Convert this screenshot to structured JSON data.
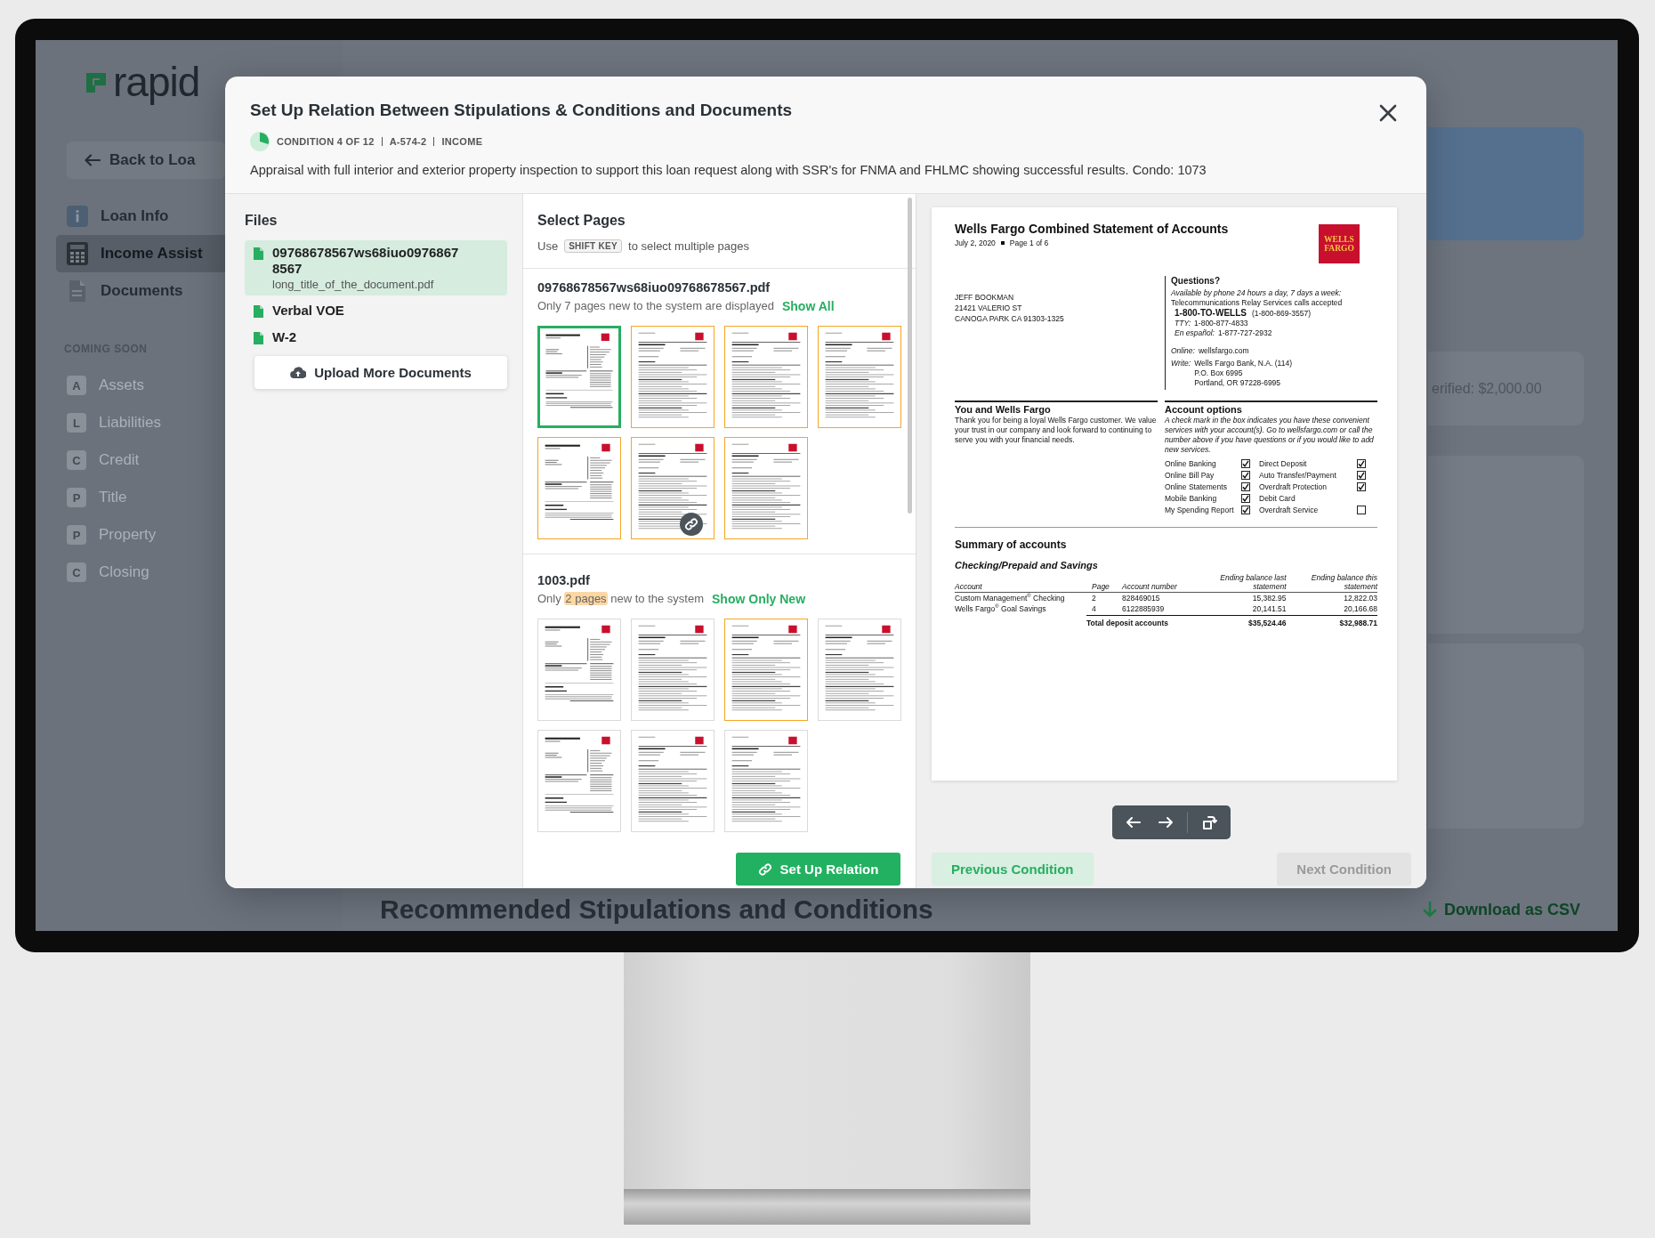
{
  "screen": {
    "logo": "rapid",
    "back_button": "Back to Loa",
    "sidebar": {
      "items": [
        {
          "label": "Loan Info",
          "selected": false
        },
        {
          "label": "Income Assist",
          "selected": true
        },
        {
          "label": "Documents",
          "selected": false
        }
      ],
      "coming_soon": {
        "heading": "COMING SOON",
        "items": [
          {
            "letter": "A",
            "label": "Assets"
          },
          {
            "letter": "L",
            "label": "Liabilities"
          },
          {
            "letter": "C",
            "label": "Credit"
          },
          {
            "letter": "P",
            "label": "Title"
          },
          {
            "letter": "P",
            "label": "Property"
          },
          {
            "letter": "C",
            "label": "Closing"
          }
        ]
      }
    },
    "summary_card": "erified: $2,000.00",
    "section_heading": "Recommended Stipulations and Conditions",
    "download_link": "Download as CSV"
  },
  "modal": {
    "title": "Set Up Relation Between Stipulations & Conditions and Documents",
    "meta": [
      "CONDITION 4 OF 12",
      "A-574-2",
      "INCOME"
    ],
    "description": "Appraisal with full interior and exterior property inspection to support this loan request along with SSR's for FNMA and FHLMC showing successful results. Condo: 1073",
    "files": {
      "heading": "Files",
      "items": [
        {
          "name": "09768678567ws68iuo09768678567",
          "subtitle": "long_title_of_the_document.pdf",
          "selected": true
        },
        {
          "name": "Verbal VOE",
          "selected": false
        },
        {
          "name": "W-2",
          "selected": false
        }
      ],
      "upload_button": "Upload More Documents"
    },
    "pages": {
      "heading": "Select Pages",
      "hint": {
        "prefix": "Use",
        "key": "SHIFT KEY",
        "suffix": "to select multiple pages"
      },
      "documents": [
        {
          "name": "09768678567ws68iuo09768678567.pdf",
          "note": [
            {
              "text": "Only 7 pages new to the system are displayed",
              "highlight": false
            }
          ],
          "link": "Show All",
          "thumbnails": [
            {
              "kind": "summary",
              "selected": true,
              "new": false,
              "linked": false
            },
            {
              "kind": "statement",
              "selected": false,
              "new": true,
              "linked": false
            },
            {
              "kind": "statement",
              "selected": false,
              "new": true,
              "linked": false
            },
            {
              "kind": "statement",
              "selected": false,
              "new": true,
              "linked": false
            },
            {
              "kind": "summary",
              "selected": false,
              "new": true,
              "linked": false
            },
            {
              "kind": "statement",
              "selected": false,
              "new": true,
              "linked": true
            },
            {
              "kind": "statement",
              "selected": false,
              "new": true,
              "linked": false
            }
          ]
        },
        {
          "name": "1003.pdf",
          "note": [
            {
              "text": "Only",
              "highlight": false
            },
            {
              "text": "2 pages",
              "highlight": true
            },
            {
              "text": "new to the system",
              "highlight": false
            }
          ],
          "link": "Show Only New",
          "thumbnails": [
            {
              "kind": "summary",
              "selected": false,
              "new": false,
              "linked": false
            },
            {
              "kind": "statement",
              "selected": false,
              "new": false,
              "linked": false
            },
            {
              "kind": "statement",
              "selected": false,
              "new": true,
              "linked": false
            },
            {
              "kind": "statement",
              "selected": false,
              "new": false,
              "linked": false
            },
            {
              "kind": "summary",
              "selected": false,
              "new": false,
              "linked": false
            },
            {
              "kind": "statement",
              "selected": false,
              "new": false,
              "linked": false
            },
            {
              "kind": "statement",
              "selected": false,
              "new": false,
              "linked": false
            }
          ]
        }
      ],
      "action_button": "Set Up Relation"
    },
    "preview": {
      "statement": {
        "title": "Wells Fargo Combined Statement of Accounts",
        "date": "July 2, 2020",
        "page": "Page 1 of 6",
        "logo": [
          "WELLS",
          "FARGO"
        ],
        "address": [
          "JEFF BOOKMAN",
          "21421 VALERIO ST",
          "CANOGA PARK CA 91303-1325"
        ],
        "questions": {
          "heading": "Questions?",
          "availability": "Available by phone 24 hours a day, 7 days a week:",
          "relay": "Telecommunications Relay Services calls accepted",
          "phone": "1-800-TO-WELLS",
          "phone_digits": "(1-800-869-3557)",
          "contacts": [
            {
              "label": "TTY:",
              "value": "1-800-877-4833"
            },
            {
              "label": "En español:",
              "value": "1-877-727-2932"
            }
          ],
          "online": {
            "label": "Online:",
            "value": "wellsfargo.com"
          },
          "write": {
            "label": "Write:",
            "lines": [
              "Wells Fargo Bank, N.A. (114)",
              "P.O. Box 6995",
              "Portland, OR 97228-6995"
            ]
          }
        },
        "relationship": {
          "heading": "You and Wells Fargo",
          "text": "Thank you for being a loyal Wells Fargo customer. We value your trust in our company and look forward to continuing to serve you with your financial needs."
        },
        "account_options": {
          "heading": "Account options",
          "text": "A check mark in the box indicates you have these convenient services with your account(s). Go to wellsfargo.com or call the number above if you have questions or if you would like to add new services.",
          "options": [
            {
              "label": "Online Banking",
              "kind": "checkbox",
              "checked": true
            },
            {
              "label": "Direct Deposit",
              "kind": "checkbox",
              "checked": true
            },
            {
              "label": "Online Bill Pay",
              "kind": "checkbox",
              "checked": true
            },
            {
              "label": "Auto Transfer/Payment",
              "kind": "checkbox",
              "checked": true
            },
            {
              "label": "Online Statements",
              "kind": "checkbox",
              "checked": true
            },
            {
              "label": "Overdraft Protection",
              "kind": "checkbox",
              "checked": true
            },
            {
              "label": "Mobile Banking",
              "kind": "checkbox",
              "checked": true
            },
            {
              "label": "Debit Card",
              "kind": "label"
            },
            {
              "label": "My Spending Report",
              "kind": "checkbox",
              "checked": true
            },
            {
              "label": "Overdraft Service",
              "kind": "checkbox",
              "checked": false
            }
          ]
        },
        "summary": {
          "heading": "Summary of accounts",
          "subheading": "Checking/Prepaid and Savings",
          "columns": [
            "Account",
            "Page",
            "Account number",
            "Ending balance last statement",
            "Ending balance this statement"
          ],
          "rows": [
            [
              "Custom Management$^{®}$ Checking",
              "2",
              "828469015",
              "15,382.95",
              "12,822.03"
            ],
            [
              "Wells Fargo$^{®}$ Goal Savings",
              "4",
              "6122885939",
              "20,141.51",
              "20,166.68"
            ]
          ],
          "total": {
            "label": "Total deposit accounts",
            "values": [
              "$35,524.46",
              "$32,988.71"
            ]
          }
        }
      },
      "previous_button": {
        "label": "Previous Condition",
        "disabled": false
      },
      "next_button": {
        "label": "Next Condition",
        "disabled": true
      }
    }
  }
}
